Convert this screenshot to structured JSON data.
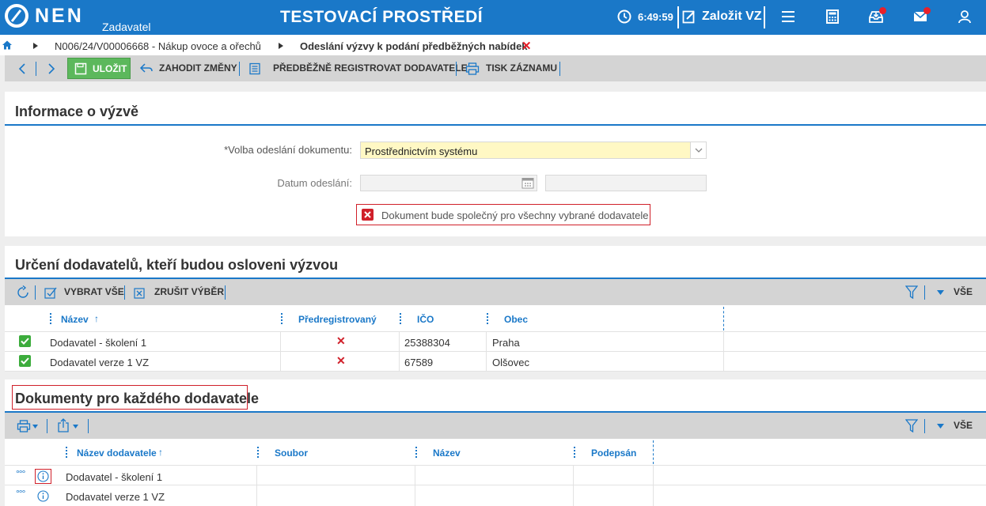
{
  "header": {
    "logo": "NEN",
    "logo_sub": "Zadavatel",
    "env_title": "TESTOVACÍ PROSTŘEDÍ",
    "time": "6:49:59",
    "new_vz": "Založit VZ"
  },
  "breadcrumb": {
    "item1": "N006/24/V00006668 - Nákup ovoce a ořechů",
    "item2": "Odeslání výzvy k podání předběžných nabídek"
  },
  "toolbar": {
    "save": "ULOŽIT",
    "discard": "ZAHODIT ZMĚNY",
    "prereg": "PŘEDBĚŽNĚ REGISTROVAT DODAVATELE",
    "print": "TISK ZÁZNAMU"
  },
  "info": {
    "title": "Informace o výzvě",
    "send_choice_label": "*Volba odeslání dokumentu:",
    "send_choice_value": "Prostřednictvím systému",
    "date_label": "Datum odeslání:",
    "common_doc": "Dokument bude společný pro všechny vybrané dodavatele"
  },
  "suppliers": {
    "title": "Určení dodavatelů, kteří budou osloveni výzvou",
    "select_all": "VYBRAT VŠE",
    "cancel_select": "ZRUŠIT VÝBĚR",
    "filter_all": "VŠE",
    "columns": [
      "Název",
      "Předregistrovaný",
      "IČO",
      "Obec"
    ],
    "rows": [
      {
        "name": "Dodavatel - školení 1",
        "ico": "25388304",
        "city": "Praha"
      },
      {
        "name": "Dodavatel verze 1 VZ",
        "ico": "67589",
        "city": "Olšovec"
      }
    ]
  },
  "documents": {
    "title": "Dokumenty pro každého dodavatele",
    "filter_all": "VŠE",
    "columns": [
      "Název dodavatele",
      "Soubor",
      "Název",
      "Podepsán"
    ],
    "rows": [
      {
        "name": "Dodavatel - školení 1"
      },
      {
        "name": "Dodavatel verze 1 VZ"
      }
    ]
  },
  "icons": {
    "logo": "nen-logo-icon",
    "clock": "clock-icon",
    "menu": "menu-icon",
    "calculator": "calculator-icon",
    "inbox": "inbox-icon",
    "mail": "mail-icon",
    "user": "user-icon"
  },
  "colors": {
    "brand": "#1a78c8",
    "save": "#5cb85c",
    "mandatory_bg": "#fff8c4",
    "error": "#d0202a"
  }
}
